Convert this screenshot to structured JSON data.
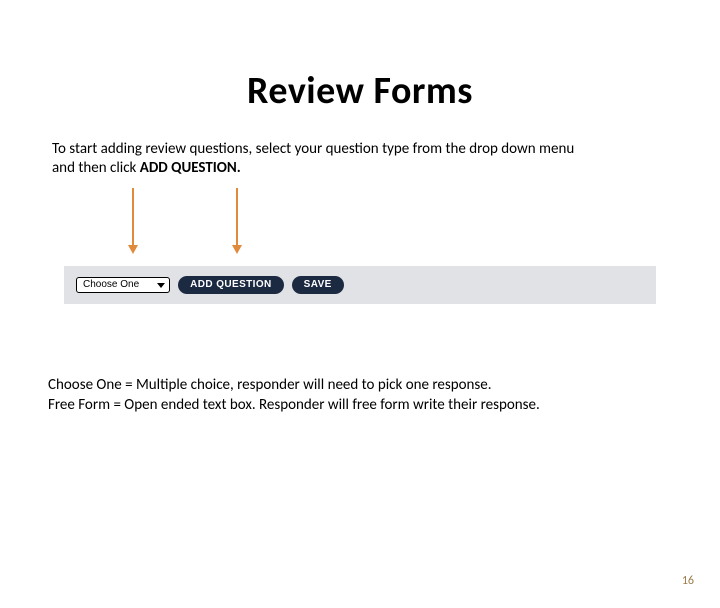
{
  "title": "Review Forms",
  "intro": {
    "line1_prefix": "To start adding review questions, select your question type from the drop down menu",
    "line2_prefix": "and then click ",
    "line2_bold": "ADD QUESTION."
  },
  "toolbar": {
    "select_label": "Choose One",
    "add_question_label": "ADD QUESTION",
    "save_label": "SAVE"
  },
  "explain": {
    "line1": "Choose One = Multiple choice, responder will need to pick one response.",
    "line2": "Free Form = Open ended text box. Responder will free form write their response."
  },
  "page_number": "16"
}
